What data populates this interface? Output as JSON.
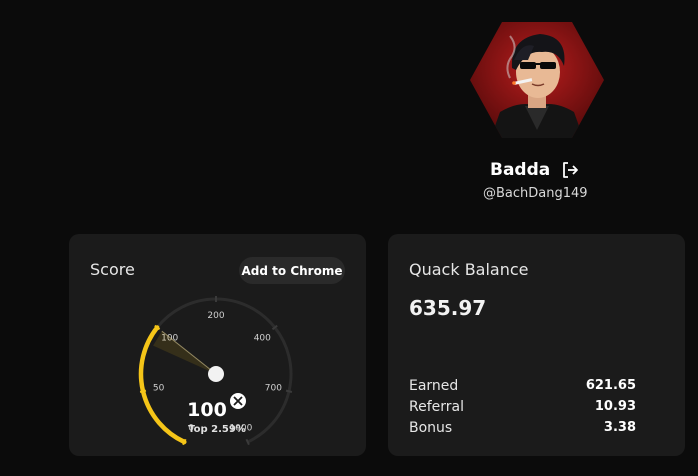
{
  "profile": {
    "name": "Badda",
    "handle": "@BachDang149",
    "avatar_icon": "user-avatar-hexagon",
    "logout_icon": "logout-icon"
  },
  "score_card": {
    "title": "Score",
    "add_to_chrome_label": "Add to Chrome",
    "gauge": {
      "value": 100,
      "value_label": "100",
      "rank_label": "Top 2.59%",
      "min": 0,
      "max": 1000,
      "ticks": [
        "0",
        "50",
        "100",
        "200",
        "400",
        "700",
        "1000"
      ],
      "accent_color": "#f5c518",
      "badge_icon": "x-logo-icon"
    }
  },
  "balance_card": {
    "title": "Quack Balance",
    "total": "635.97",
    "rows": [
      {
        "label": "Earned",
        "value": "621.65"
      },
      {
        "label": "Referral",
        "value": "10.93"
      },
      {
        "label": "Bonus",
        "value": "3.38"
      }
    ]
  },
  "colors": {
    "background": "#0b0b0b",
    "card": "#1b1b1b",
    "accent": "#f5c518"
  }
}
